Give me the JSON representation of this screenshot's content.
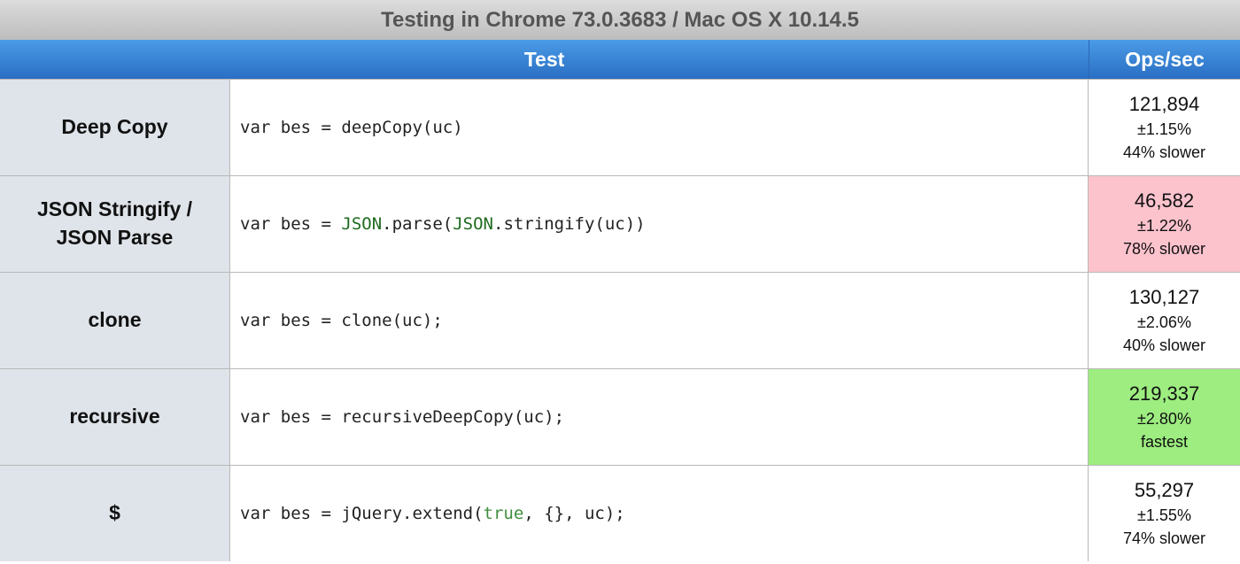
{
  "title": "Testing in Chrome 73.0.3683 / Mac OS X 10.14.5",
  "header": {
    "test_label": "Test",
    "ops_label": "Ops/sec"
  },
  "colors": {
    "slowest_bg": "#fcc3cd",
    "fastest_bg": "#9ded80",
    "header_blue": "#2a6fc4"
  },
  "rows": [
    {
      "name": "Deep Copy",
      "code": {
        "prefix": "var bes = deepCopy(uc)"
      },
      "ops": "121,894",
      "error": "±1.15%",
      "relative": "44% slower",
      "highlight": "none"
    },
    {
      "name_line1": "JSON Stringify /",
      "name_line2": "JSON Parse",
      "code": {
        "p1": "var bes = ",
        "g1": "JSON",
        "p2": ".parse(",
        "g2": "JSON",
        "p3": ".stringify(uc))"
      },
      "ops": "46,582",
      "error": "±1.22%",
      "relative": "78% slower",
      "highlight": "slowest"
    },
    {
      "name": "clone",
      "code": {
        "prefix": "var bes = clone(uc);"
      },
      "ops": "130,127",
      "error": "±2.06%",
      "relative": "40% slower",
      "highlight": "none"
    },
    {
      "name": "recursive",
      "code": {
        "prefix": "var bes = recursiveDeepCopy(uc);"
      },
      "ops": "219,337",
      "error": "±2.80%",
      "relative": "fastest",
      "highlight": "fastest"
    },
    {
      "name": "$",
      "code": {
        "p1": "var bes = jQuery.extend(",
        "b1": "true",
        "p2": ", {}, uc);"
      },
      "ops": "55,297",
      "error": "±1.55%",
      "relative": "74% slower",
      "highlight": "none"
    }
  ]
}
